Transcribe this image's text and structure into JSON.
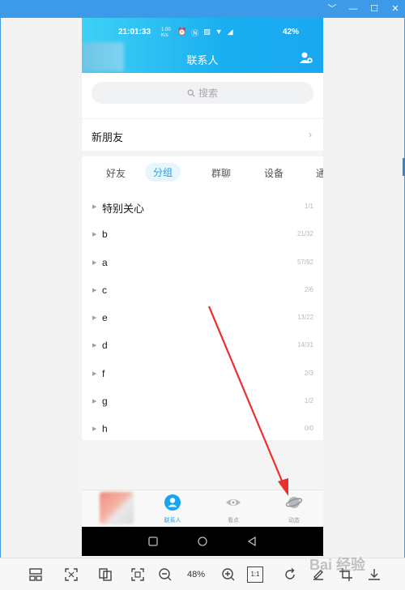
{
  "window": {
    "controls": [
      "﹀",
      "—",
      "☐",
      "✕"
    ]
  },
  "status_bar": {
    "time": "21:01:33",
    "battery": "42%",
    "net_speed": "1.00 K/s"
  },
  "header": {
    "title": "联系人"
  },
  "search": {
    "placeholder": "搜索"
  },
  "new_friend": {
    "label": "新朋友"
  },
  "tabs": [
    {
      "label": "好友",
      "active": false
    },
    {
      "label": "分组",
      "active": true
    },
    {
      "label": "群聊",
      "active": false
    },
    {
      "label": "设备",
      "active": false
    },
    {
      "label": "通",
      "active": false
    }
  ],
  "groups": [
    {
      "name": "特别关心",
      "count": "1/1"
    },
    {
      "name": "b",
      "count": "21/32"
    },
    {
      "name": "a",
      "count": "57/92"
    },
    {
      "name": "c",
      "count": "2/6"
    },
    {
      "name": "e",
      "count": "13/22"
    },
    {
      "name": "d",
      "count": "14/31"
    },
    {
      "name": "f",
      "count": "2/3"
    },
    {
      "name": "g",
      "count": "1/2"
    },
    {
      "name": "h",
      "count": "0/0"
    }
  ],
  "bottom_nav": [
    {
      "label": "联系人",
      "active": true,
      "icon": "contacts-icon"
    },
    {
      "label": "看点",
      "active": false,
      "icon": "eye-icon"
    },
    {
      "label": "动态",
      "active": false,
      "icon": "planet-icon"
    }
  ],
  "toolbar": {
    "zoom": "48%",
    "ratio_label": "1:1"
  },
  "watermark": "Bai 经验",
  "colors": {
    "accent": "#18a5f0",
    "arrow": "#e8302f",
    "window_frame": "#3c9ae8"
  }
}
